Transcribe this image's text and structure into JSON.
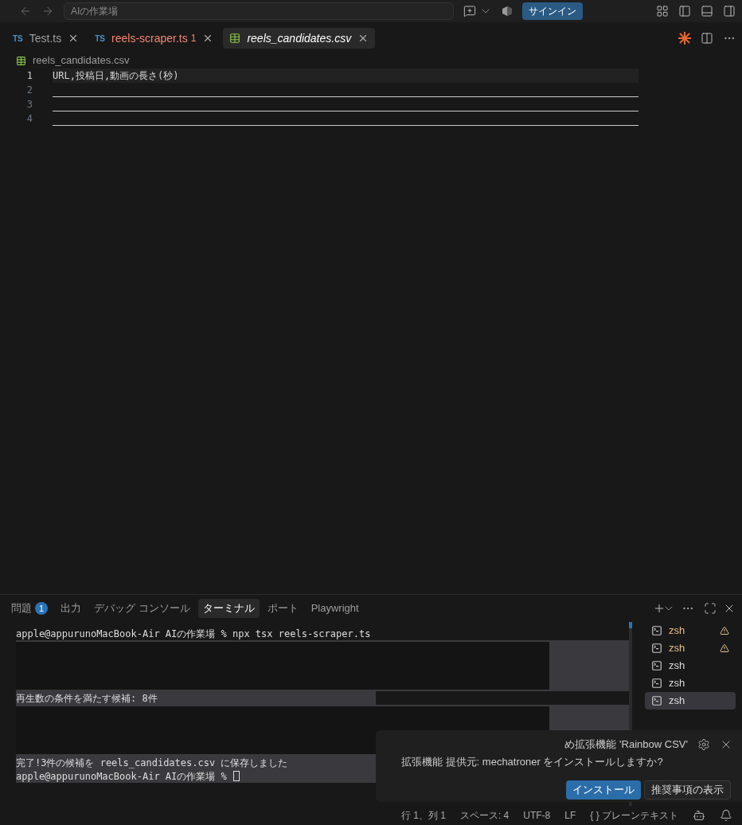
{
  "titlebar": {
    "search_placeholder": "AIの作業場",
    "signin": "サインイン"
  },
  "tabs": [
    {
      "label": "Test.ts",
      "badge": "TS",
      "kind": "ts",
      "selected": false,
      "error": false
    },
    {
      "label": "reels-scraper.ts",
      "badge": "TS",
      "kind": "ts",
      "selected": false,
      "error_count": "1",
      "error": true
    },
    {
      "label": "reels_candidates.csv",
      "kind": "csv",
      "selected": true,
      "error": false
    }
  ],
  "breadcrumb": "reels_candidates.csv",
  "editor": {
    "lines": [
      {
        "number": "1",
        "text": "URL,投稿日,動画の長さ(秒)",
        "current": true
      },
      {
        "number": "2",
        "current": false
      },
      {
        "number": "3",
        "current": false
      },
      {
        "number": "4",
        "current": false
      }
    ]
  },
  "panel": {
    "tabs": [
      {
        "label": "問題",
        "count": "1",
        "selected": false
      },
      {
        "label": "出力",
        "selected": false
      },
      {
        "label": "デバッグ コンソール",
        "selected": false
      },
      {
        "label": "ターミナル",
        "selected": true
      },
      {
        "label": "ポート",
        "selected": false
      },
      {
        "label": "Playwright",
        "selected": false
      }
    ],
    "terminal": [
      {
        "kind": "text",
        "text": "apple@appurunoMacBook-Air AIの作業場 % npx tsx reels-scraper.ts"
      },
      {
        "kind": "hidden"
      },
      {
        "kind": "text",
        "text": "再生数の条件を満たす候補: 8件"
      },
      {
        "kind": "hidden"
      },
      {
        "kind": "text",
        "text": "完了!3件の候補を reels_candidates.csv に保存しました"
      },
      {
        "kind": "prompt",
        "text": "apple@appurunoMacBook-Air AIの作業場 %"
      }
    ],
    "sessions": [
      {
        "label": "zsh",
        "warning": true,
        "selected": false
      },
      {
        "label": "zsh",
        "warning": true,
        "selected": false
      },
      {
        "label": "zsh",
        "warning": false,
        "selected": false
      },
      {
        "label": "zsh",
        "warning": false,
        "selected": false
      },
      {
        "label": "zsh",
        "warning": false,
        "selected": true
      }
    ]
  },
  "notification": {
    "line1": "め拡張機能 'Rainbow CSV'",
    "line2": "拡張機能 提供元: mechatroner をインストールしますか?",
    "buttons": [
      {
        "label": "インストール",
        "primary": true
      },
      {
        "label": "推奨事項の表示",
        "primary": false
      }
    ]
  },
  "status_bar": [
    "行 1、列 1",
    "スペース: 4",
    "UTF-8",
    "LF",
    "{ } プレーンテキスト"
  ]
}
